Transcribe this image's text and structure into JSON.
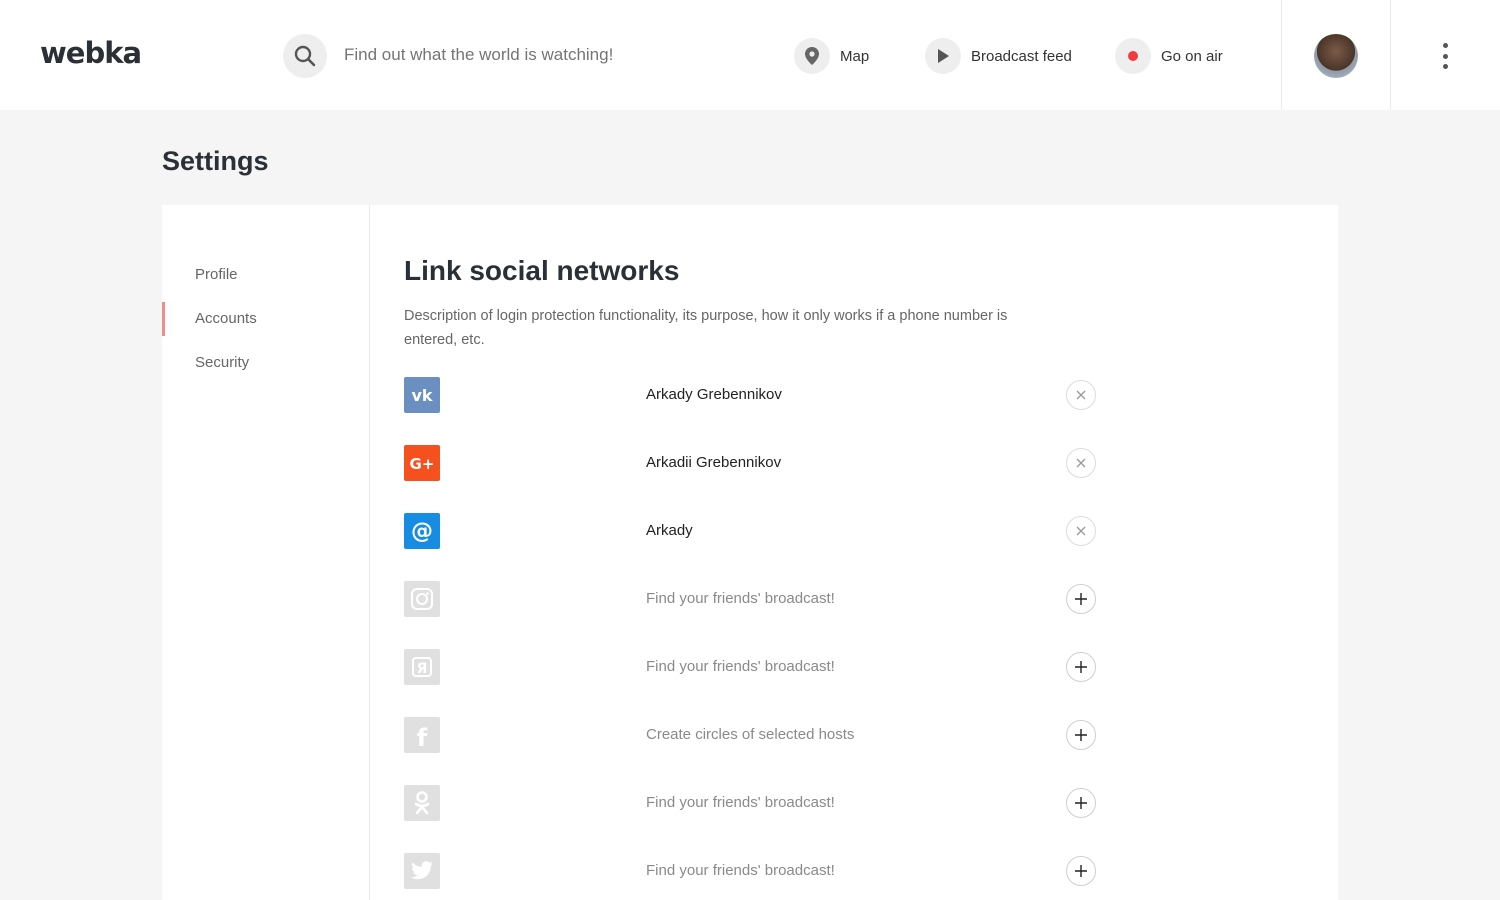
{
  "header": {
    "logo": "webka",
    "search_placeholder": "Find out what the world is watching!",
    "nav": {
      "map": "Map",
      "feed": "Broadcast feed",
      "air": "Go on air"
    }
  },
  "page": {
    "title": "Settings"
  },
  "sidebar": {
    "items": [
      {
        "label": "Profile",
        "active": false
      },
      {
        "label": "Accounts",
        "active": true
      },
      {
        "label": "Security",
        "active": false
      }
    ]
  },
  "main": {
    "title": "Link social networks",
    "description": "Description of login protection functionality, its purpose, how it only works if a phone number is entered, etc.",
    "accounts": [
      {
        "network": "vk",
        "icon": "vk-icon",
        "text": "Arkady Grebennikov",
        "linked": true,
        "color": "#6a8fc0"
      },
      {
        "network": "google-plus",
        "icon": "google-plus-icon",
        "text": "Arkadii Grebennikov",
        "linked": true,
        "color": "#f4511e"
      },
      {
        "network": "mail",
        "icon": "at-sign-icon",
        "text": "Arkady",
        "linked": true,
        "color": "#168de2"
      },
      {
        "network": "instagram",
        "icon": "instagram-icon",
        "text": "Find your friends' broadcast!",
        "linked": false,
        "color": "#e0e0e0"
      },
      {
        "network": "yandex",
        "icon": "yandex-icon",
        "text": "Find your friends' broadcast!",
        "linked": false,
        "color": "#e0e0e0"
      },
      {
        "network": "facebook",
        "icon": "facebook-icon",
        "text": "Create circles of selected hosts",
        "linked": false,
        "color": "#e0e0e0"
      },
      {
        "network": "odnoklassniki",
        "icon": "odnoklassniki-icon",
        "text": "Find your friends' broadcast!",
        "linked": false,
        "color": "#e0e0e0"
      },
      {
        "network": "twitter",
        "icon": "twitter-icon",
        "text": "Find your friends' broadcast!",
        "linked": false,
        "color": "#e0e0e0"
      }
    ]
  },
  "colors": {
    "accent_active": "#f28b8b",
    "record": "#f03c3c",
    "background": "#f5f5f5"
  }
}
